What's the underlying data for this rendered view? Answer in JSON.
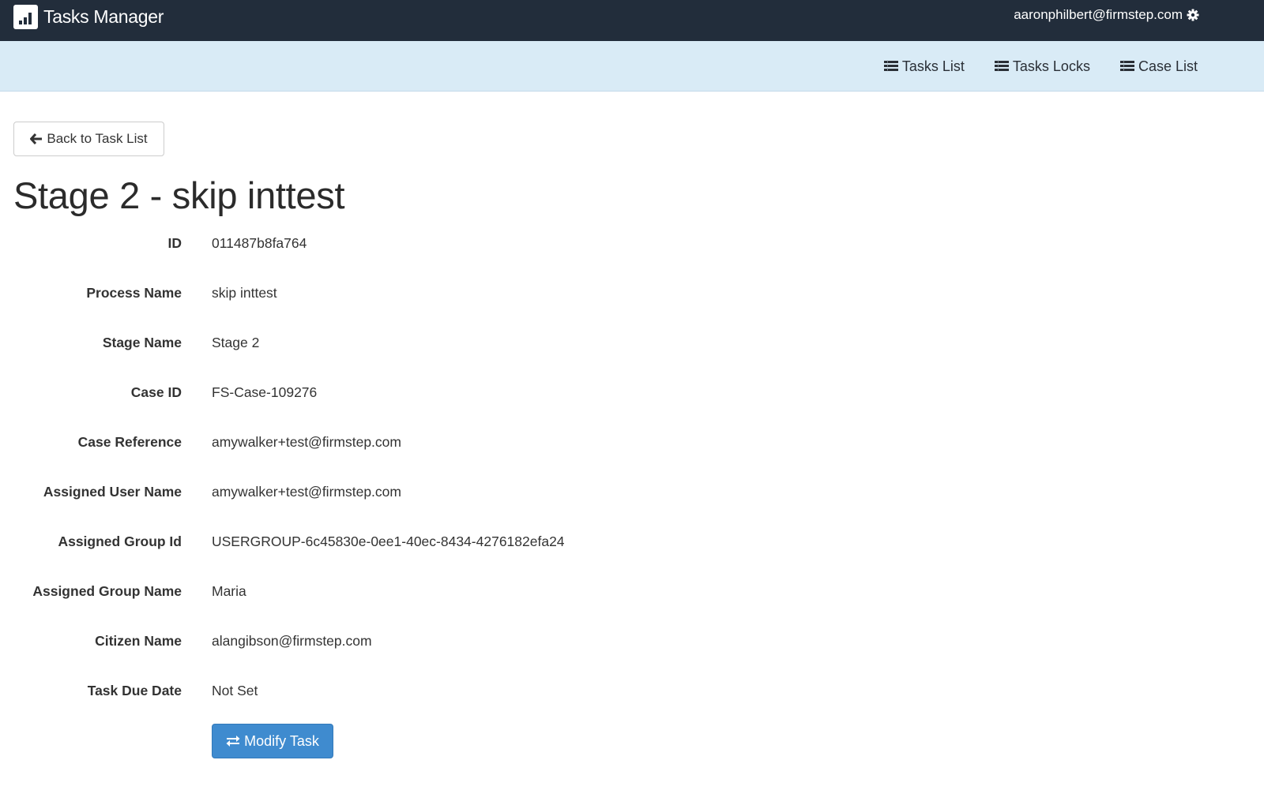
{
  "app": {
    "title": "Tasks Manager",
    "logo_icon": "bar-chart-icon"
  },
  "user_menu": {
    "email": "aaronphilbert@firmstep.com",
    "icon": "gear-icon"
  },
  "nav": {
    "items": [
      {
        "label": "Tasks List",
        "icon": "list-icon"
      },
      {
        "label": "Tasks Locks",
        "icon": "list-icon"
      },
      {
        "label": "Case List",
        "icon": "list-icon"
      }
    ]
  },
  "back_button": {
    "label": "Back to Task List",
    "icon": "arrow-left-icon"
  },
  "page": {
    "title": "Stage 2 - skip inttest"
  },
  "details": [
    {
      "label": "ID",
      "value": "011487b8fa764"
    },
    {
      "label": "Process Name",
      "value": "skip inttest"
    },
    {
      "label": "Stage Name",
      "value": "Stage 2"
    },
    {
      "label": "Case ID",
      "value": "FS-Case-109276"
    },
    {
      "label": "Case Reference",
      "value": "amywalker+test@firmstep.com"
    },
    {
      "label": "Assigned User Name",
      "value": "amywalker+test@firmstep.com"
    },
    {
      "label": "Assigned Group Id",
      "value": "USERGROUP-6c45830e-0ee1-40ec-8434-4276182efa24"
    },
    {
      "label": "Assigned Group Name",
      "value": "Maria"
    },
    {
      "label": "Citizen Name",
      "value": "alangibson@firmstep.com"
    },
    {
      "label": "Task Due Date",
      "value": "Not Set"
    }
  ],
  "modify_button": {
    "label": "Modify Task",
    "icon": "swap-arrows-icon"
  },
  "colors": {
    "topbar": "#222d3b",
    "subbar": "#d9ebf6",
    "primary": "#3f8bcf"
  }
}
